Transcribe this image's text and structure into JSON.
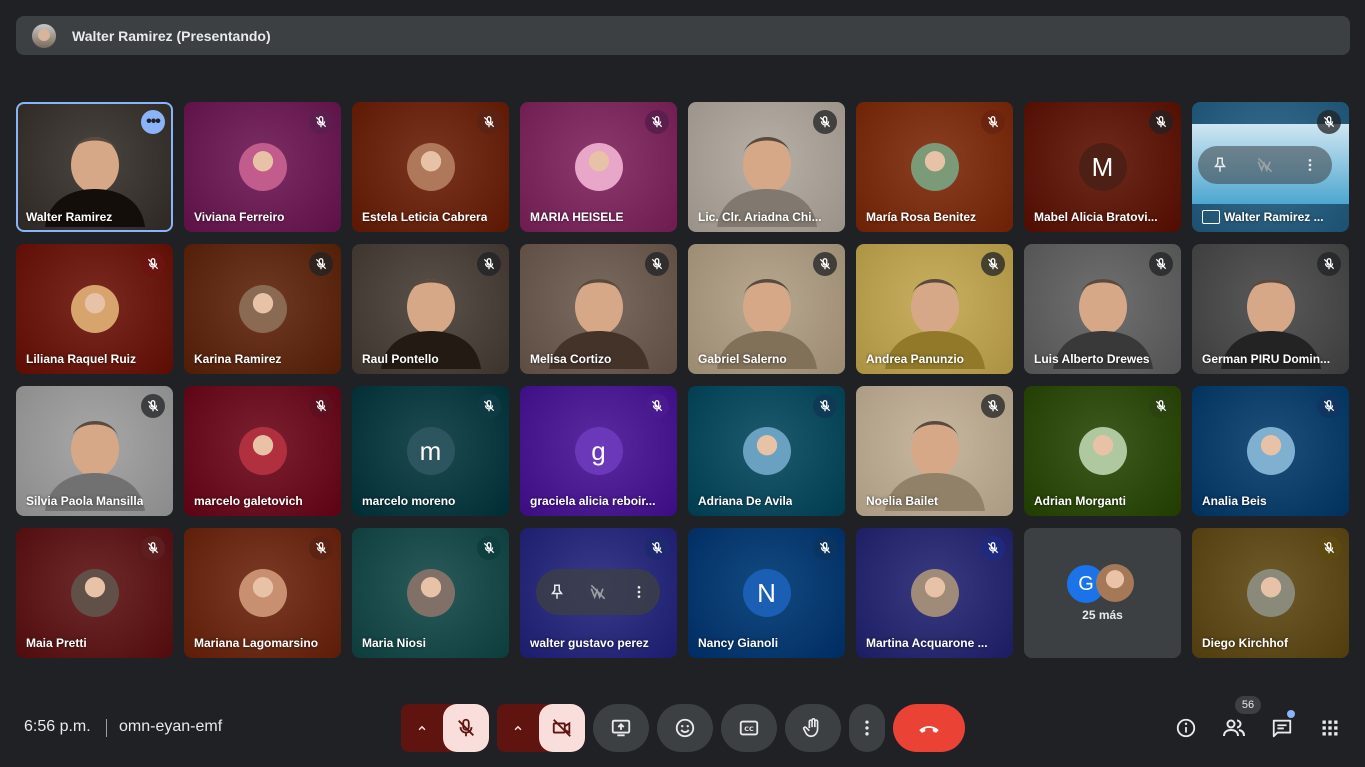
{
  "presenter": {
    "label": "Walter Ramirez (Presentando)"
  },
  "tiles": [
    {
      "name": "Walter Ramirez",
      "kind": "video",
      "bg": "#4a4540",
      "selected": true
    },
    {
      "name": "Viviana Ferreiro",
      "kind": "photo",
      "bg": "#7b2e63",
      "mic": "#5c1e4d",
      "photo": "#c25c8c"
    },
    {
      "name": "Estela Leticia Cabrera",
      "kind": "photo",
      "bg": "#7a3520",
      "mic": "#5b2313",
      "photo": "#b0785a"
    },
    {
      "name": "MARIA HEISELE",
      "kind": "photo",
      "bg": "#8c3a6e",
      "mic": "#5c1e4d",
      "photo": "#e8a6c8"
    },
    {
      "name": "Lic. Clr. Ariadna Chi...",
      "kind": "video",
      "bg": "#b8b0a6"
    },
    {
      "name": "María Rosa Benitez",
      "kind": "photo",
      "bg": "#8a3e22",
      "mic": "#6b2410",
      "photo": "#7a9a78"
    },
    {
      "name": "Mabel Alicia Bratovi...",
      "kind": "letter",
      "bg": "#6e2a1c",
      "letter": "M",
      "letterbg": "#4e1f15"
    },
    {
      "name": "Walter Ramirez ...",
      "kind": "screen",
      "bg": "#3a6e8e"
    },
    {
      "name": "Liliana Raquel Ruiz",
      "kind": "photo",
      "bg": "#7a2a20",
      "mic": "#6b1410",
      "photo": "#d8a46e"
    },
    {
      "name": "Karina Ramirez",
      "kind": "photo",
      "bg": "#6e3a24",
      "mic": "",
      "photo": "#8a6a52"
    },
    {
      "name": "Raul Pontello",
      "kind": "video",
      "bg": "#5a524a"
    },
    {
      "name": "Melisa Cortizo",
      "kind": "video",
      "bg": "#7a6a60"
    },
    {
      "name": "Gabriel Salerno",
      "kind": "video",
      "bg": "#b8a890"
    },
    {
      "name": "Andrea Panunzio",
      "kind": "video",
      "bg": "#c8b060"
    },
    {
      "name": "Luis Alberto Drewes",
      "kind": "video",
      "bg": "#707070"
    },
    {
      "name": "German PIRU Domin...",
      "kind": "video",
      "bg": "#5a5a5a"
    },
    {
      "name": "Silvia Paola Mansilla",
      "kind": "video",
      "bg": "#a8a8a8"
    },
    {
      "name": "marcelo galetovich",
      "kind": "photo",
      "bg": "#7a2030",
      "mic": "#5c1020",
      "photo": "#b03040"
    },
    {
      "name": "marcelo moreno",
      "kind": "letter",
      "bg": "#1e4a52",
      "letter": "m",
      "letterbg": "#2c5560",
      "mic": "#0f3a44"
    },
    {
      "name": "graciela alicia reboir...",
      "kind": "letter",
      "bg": "#5a2aa0",
      "letter": "g",
      "letterbg": "#6a38b8",
      "mic": "#4a1a90"
    },
    {
      "name": "Adriana De Avila",
      "kind": "photo",
      "bg": "#1e5a6e",
      "mic": "#0f3a55",
      "photo": "#6aa0c0"
    },
    {
      "name": "Noelia Bailet",
      "kind": "video",
      "bg": "#c8b8a0"
    },
    {
      "name": "Adrian Morganti",
      "kind": "photo",
      "bg": "#3e5a1e",
      "mic": "#2c4210",
      "photo": "#b0c8a0"
    },
    {
      "name": "Analia Beis",
      "kind": "photo",
      "bg": "#1e4e7a",
      "mic": "#0f3560",
      "photo": "#80b0d0"
    },
    {
      "name": "Maia Pretti",
      "kind": "photo",
      "bg": "#6e2a2a",
      "mic": "#5c1e1e",
      "photo": "#605048"
    },
    {
      "name": "Mariana Lagomarsino",
      "kind": "photo",
      "bg": "#7a3a26",
      "mic": "#5c2313",
      "photo": "#c89070"
    },
    {
      "name": "Maria Niosi",
      "kind": "photo",
      "bg": "#2a5a5a",
      "mic": "#0f4040",
      "photo": "#807068"
    },
    {
      "name": "walter gustavo perez",
      "kind": "hover",
      "bg": "#3a3a8a",
      "mic": "#1e2a70"
    },
    {
      "name": "Nancy Gianoli",
      "kind": "letter",
      "bg": "#124a80",
      "letter": "N",
      "letterbg": "#1a5fb4",
      "mic": "#0a3560"
    },
    {
      "name": "Martina Acquarone ...",
      "kind": "photo",
      "bg": "#3a3a80",
      "mic": "#1e2a80",
      "photo": "#a08a78"
    },
    {
      "name": "25 más",
      "kind": "more",
      "bg": "#3c4043"
    },
    {
      "name": "Diego Kirchhof",
      "kind": "photo",
      "bg": "#6e5a2a",
      "mic": "#5c4a10",
      "photo": "#8a8a7a"
    }
  ],
  "more": {
    "letter": "G",
    "label": "25 más"
  },
  "footer": {
    "time": "6:56 p.m.",
    "meeting_code": "omn-eyan-emf",
    "participants_count": "56"
  },
  "colors": {
    "background": "#202124",
    "surface": "#3c4043",
    "hangup": "#ea4335",
    "muted_red_bg": "#601410",
    "muted_red_main": "#f9dedc",
    "accent_blue": "#8ab4f8"
  },
  "icons": [
    "mic-off-icon",
    "camera-off-icon",
    "present-icon",
    "emoji-icon",
    "captions-icon",
    "raise-hand-icon",
    "more-vert-icon",
    "hangup-icon",
    "info-icon",
    "people-icon",
    "chat-icon",
    "activities-icon",
    "pin-icon",
    "chevron-up-icon"
  ]
}
